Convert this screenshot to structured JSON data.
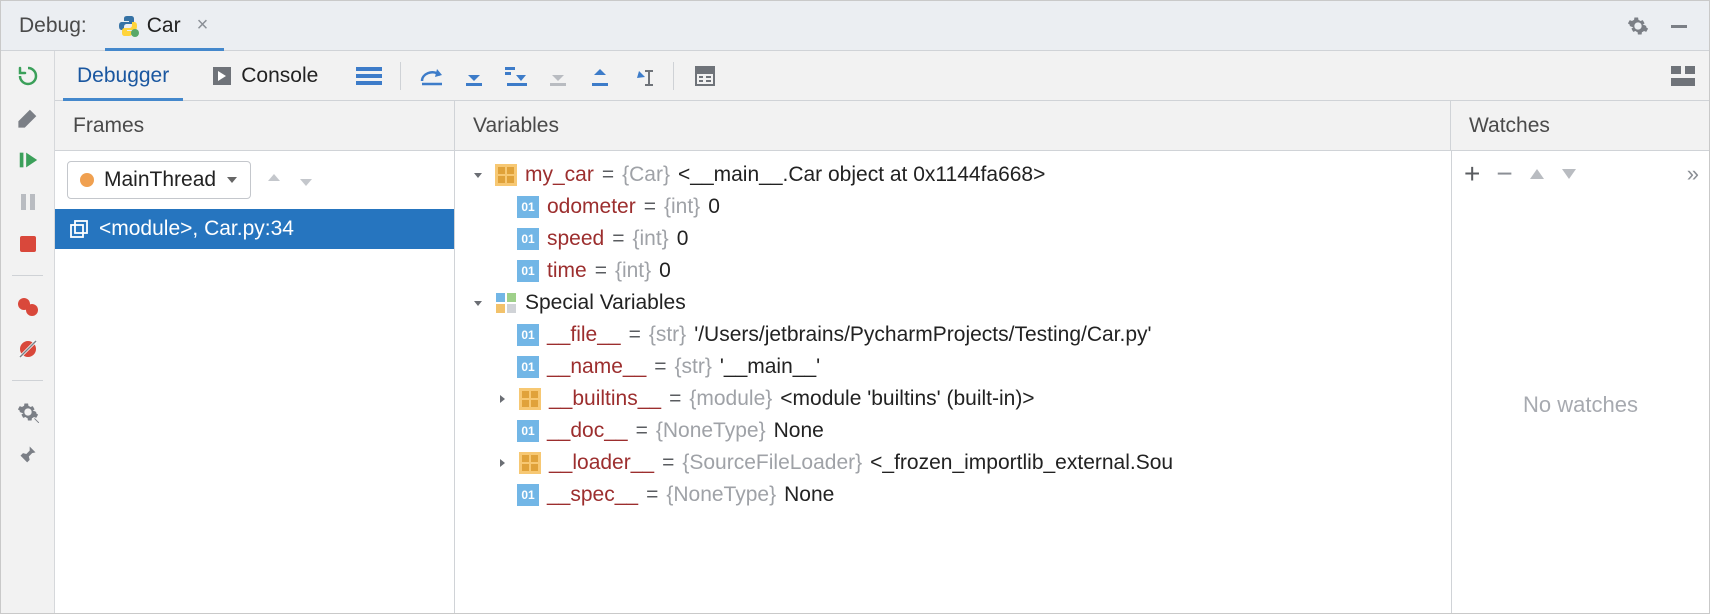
{
  "topbar": {
    "label": "Debug:",
    "tab_name": "Car"
  },
  "tabs": {
    "debugger": "Debugger",
    "console": "Console"
  },
  "panes": {
    "frames": "Frames",
    "variables": "Variables",
    "watches": "Watches"
  },
  "frames": {
    "thread": "MainThread",
    "item": "<module>, Car.py:34"
  },
  "vars": {
    "my_car": {
      "name": "my_car",
      "type": "{Car}",
      "value": "<__main__.Car object at 0x1144fa668>"
    },
    "odometer": {
      "name": "odometer",
      "type": "{int}",
      "value": "0"
    },
    "speed": {
      "name": "speed",
      "type": "{int}",
      "value": "0"
    },
    "time": {
      "name": "time",
      "type": "{int}",
      "value": "0"
    },
    "special_label": "Special Variables",
    "file": {
      "name": "__file__",
      "type": "{str}",
      "value": "'/Users/jetbrains/PycharmProjects/Testing/Car.py'"
    },
    "name": {
      "name": "__name__",
      "type": "{str}",
      "value": "'__main__'"
    },
    "builtins": {
      "name": "__builtins__",
      "type": "{module}",
      "value": "<module 'builtins' (built-in)>"
    },
    "doc": {
      "name": "__doc__",
      "type": "{NoneType}",
      "value": "None"
    },
    "loader": {
      "name": "__loader__",
      "type": "{SourceFileLoader}",
      "value": "<_frozen_importlib_external.Sou"
    },
    "spec": {
      "name": "__spec__",
      "type": "{NoneType}",
      "value": "None"
    }
  },
  "watches": {
    "empty": "No watches"
  }
}
